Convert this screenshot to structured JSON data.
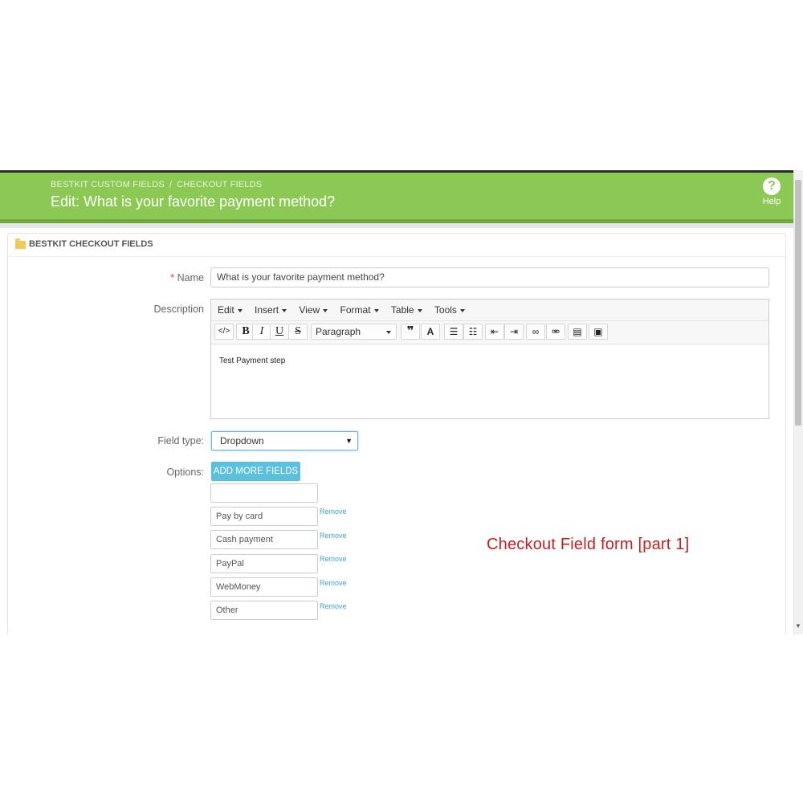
{
  "breadcrumb": {
    "part1": "BESTKIT CUSTOM FIELDS",
    "separator": "/",
    "part2": "CHECKOUT FIELDS"
  },
  "header": {
    "title": "Edit: What is your favorite payment method?",
    "help_label": "Help",
    "help_icon": "?"
  },
  "panel": {
    "title": "BESTKIT CHECKOUT FIELDS"
  },
  "form": {
    "name_required_mark": "*",
    "name_label": "Name",
    "name_value": "What is your favorite payment method?",
    "description_label": "Description",
    "field_type_label": "Field type:",
    "field_type_value": "Dropdown",
    "options_label": "Options:",
    "add_more_label": "ADD MORE FIELDS",
    "options": [
      {
        "value": "",
        "remove": ""
      },
      {
        "value": "Pay by card",
        "remove": "Remove"
      },
      {
        "value": "Cash payment",
        "remove": "Remove"
      },
      {
        "value": "PayPal",
        "remove": "Remove"
      },
      {
        "value": "WebMoney",
        "remove": "Remove"
      },
      {
        "value": "Other",
        "remove": "Remove"
      }
    ]
  },
  "editor": {
    "menu": [
      "Edit",
      "Insert",
      "View",
      "Format",
      "Table",
      "Tools"
    ],
    "paragraph_label": "Paragraph",
    "content": "Test Payment step",
    "icons": [
      "source-code-icon",
      "bold-icon",
      "italic-icon",
      "underline-icon",
      "strikethrough-icon",
      "blockquote-icon",
      "text-color-icon",
      "bullet-list-icon",
      "numbered-list-icon",
      "outdent-icon",
      "indent-icon",
      "link-icon",
      "unlink-icon",
      "media-icon",
      "image-icon"
    ]
  },
  "caption": "Checkout Field form [part 1]",
  "colors": {
    "header_green": "#8bc954",
    "button_blue": "#5bc0de",
    "link_blue": "#3aa3d8",
    "caption_red": "#c42020",
    "required_red": "#e23b3b"
  }
}
